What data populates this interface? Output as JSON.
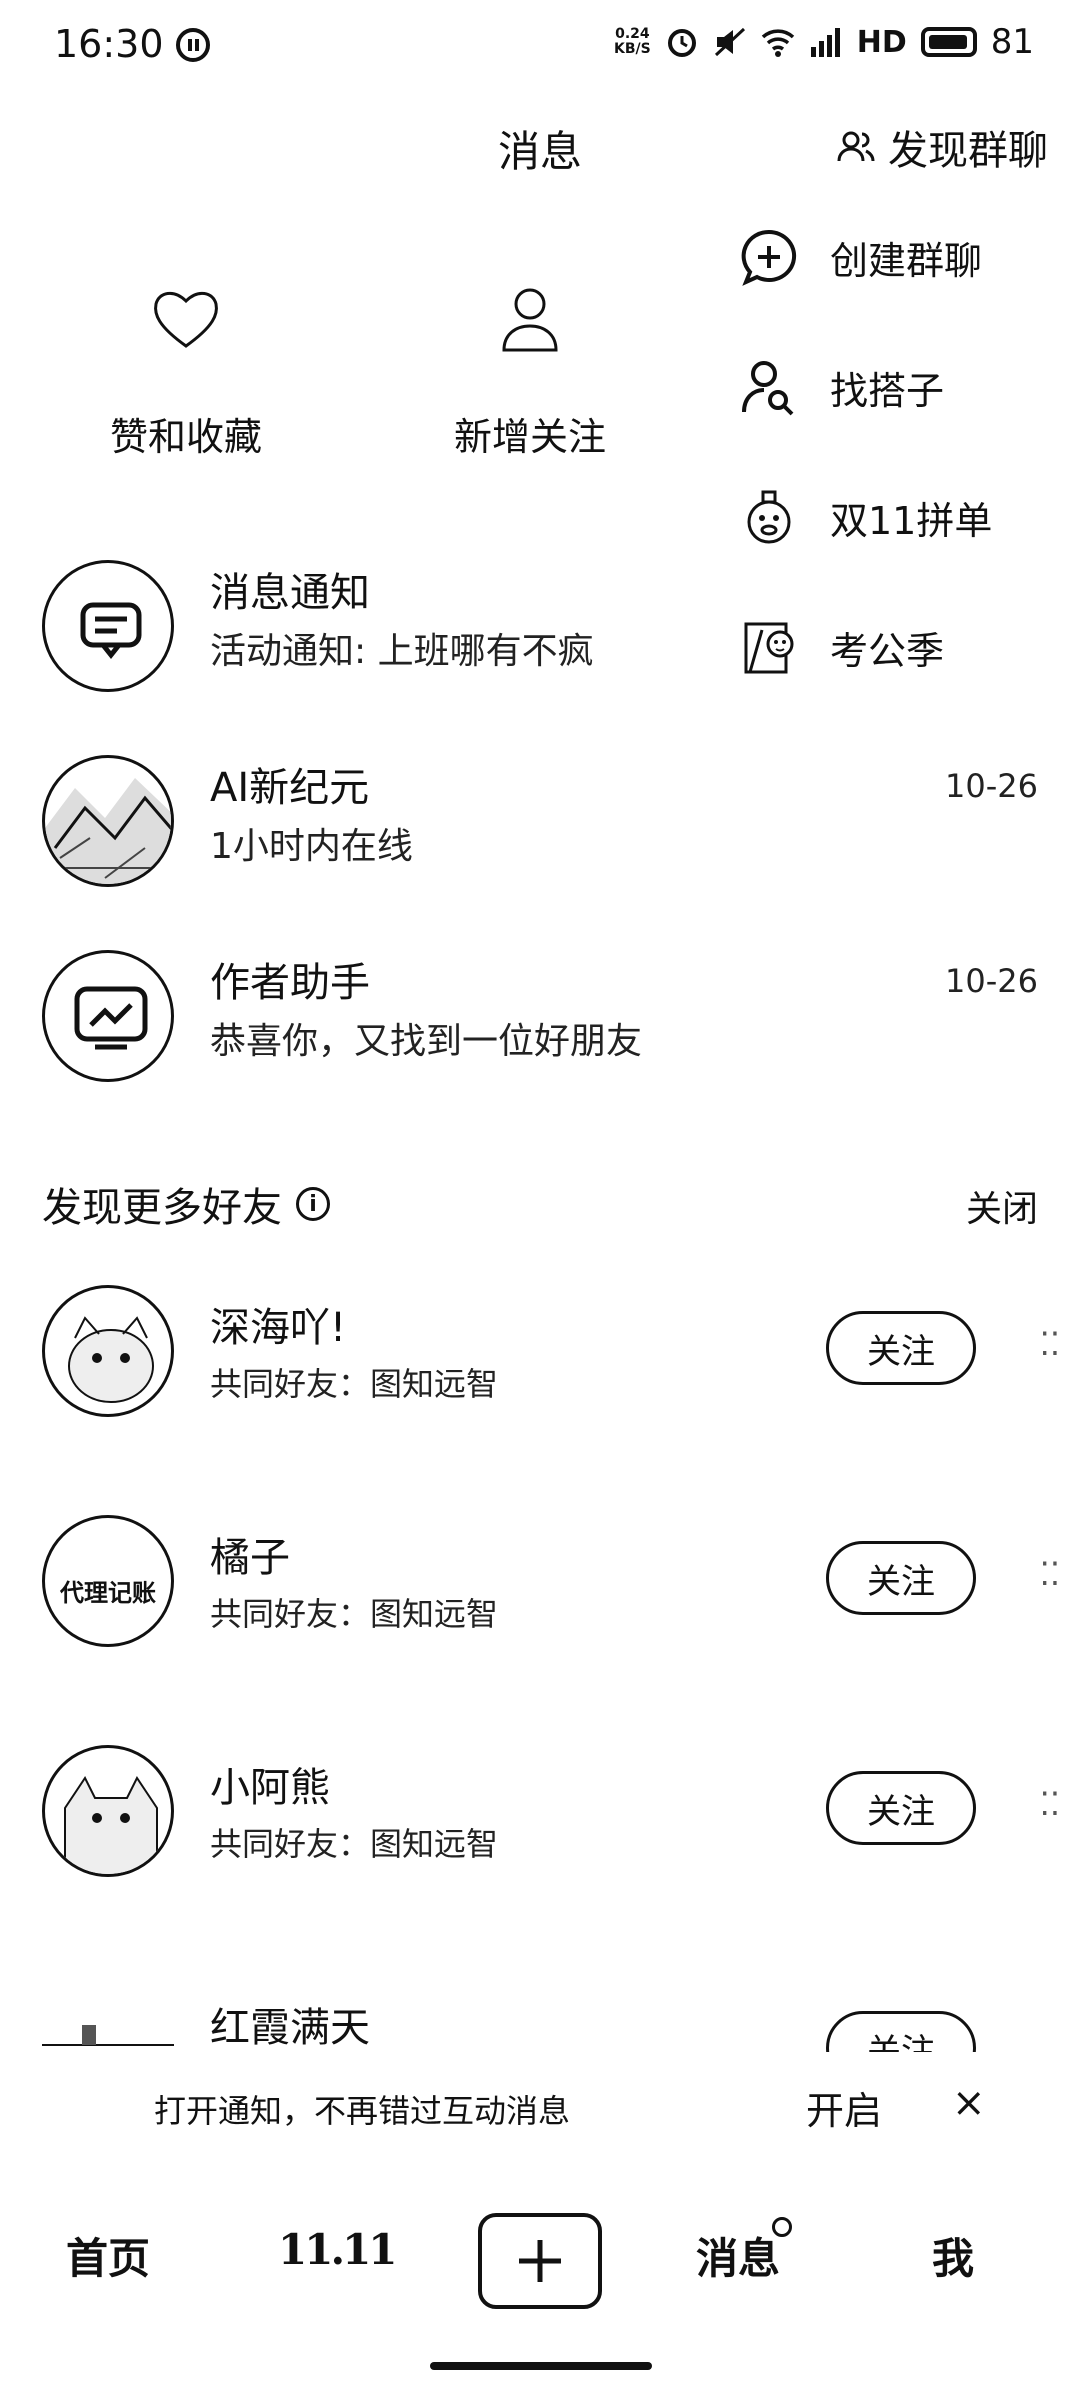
{
  "status_bar": {
    "time": "16:30",
    "net_speed_value": "0.24",
    "net_speed_unit": "KB/S",
    "network": "HD",
    "battery": "81"
  },
  "header": {
    "title": "消息",
    "discover_group": "发现群聊"
  },
  "quick_actions": [
    {
      "label": "赞和收藏",
      "icon": "heart-icon"
    },
    {
      "label": "新增关注",
      "icon": "person-icon"
    }
  ],
  "popup_menu": [
    {
      "label": "创建群聊",
      "icon": "chat-plus-icon"
    },
    {
      "label": "找搭子",
      "icon": "find-person-icon"
    },
    {
      "label": "双11拼单",
      "icon": "mascot-icon"
    },
    {
      "label": "考公季",
      "icon": "exam-icon"
    }
  ],
  "conversations": [
    {
      "name": "消息通知",
      "preview": "活动通知: 上班哪有不疯",
      "time": ""
    },
    {
      "name": "AI新纪元",
      "preview": "1小时内在线",
      "time": "10-26"
    },
    {
      "name": "作者助手",
      "preview": "恭喜你，又找到一位好朋友",
      "time": "10-26"
    }
  ],
  "discover_section": {
    "title": "发现更多好友",
    "close": "关闭"
  },
  "friends": [
    {
      "name": "深海吖!",
      "mutual": "共同好友：图知远智",
      "follow": "关注"
    },
    {
      "name": "橘子",
      "mutual": "共同好友：图知远智",
      "follow": "关注"
    },
    {
      "name": "小阿熊",
      "mutual": "共同好友：图知远智",
      "follow": "关注"
    },
    {
      "name": "红霞满天",
      "mutual": "",
      "follow": "关注"
    }
  ],
  "avatar_text": "代理记账",
  "notification_banner": {
    "text": "打开通知，不再错过互动消息",
    "action": "开启",
    "close": "×"
  },
  "bottom_nav": {
    "home": "首页",
    "promo": "11.11",
    "messages": "消息",
    "me": "我"
  }
}
